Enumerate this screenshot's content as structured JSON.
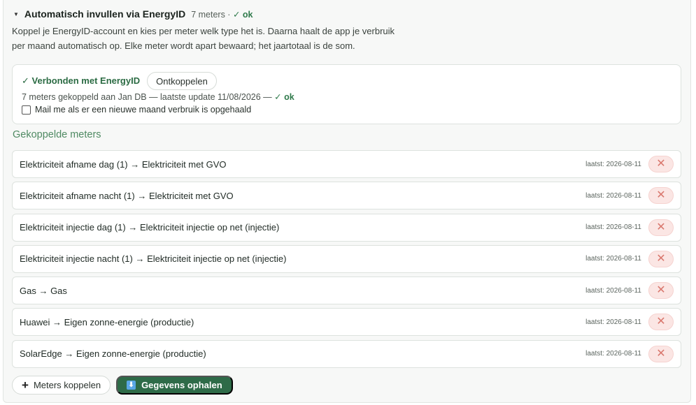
{
  "summary": {
    "caret": "▼",
    "title": "Automatisch invullen via EnergyID",
    "meta": "7 meters ·",
    "status": "✓ ok"
  },
  "intro": "Koppel je EnergyID-account en kies per meter welk type het is. Daarna haalt de app je verbruik per maand automatisch op. Elke meter wordt apart bewaard; het jaartotaal is de som.",
  "connection": {
    "status": "✓ Verbonden met EnergyID",
    "disconnect_label": "Ontkoppelen",
    "details": "7 meters gekoppeld aan Jan DB — laatste update 11/08/2026 —",
    "details_ok": "✓ ok",
    "mail_label": "Mail me als er een nieuwe maand verbruik is opgehaald",
    "mail_checked": false
  },
  "section_title": "Gekoppelde meters",
  "meters": [
    {
      "label": "Elektriciteit afname dag (1) → Elektriciteit met GVO",
      "date": "laatst: 2026-08-11"
    },
    {
      "label": "Elektriciteit afname nacht (1) → Elektriciteit met GVO",
      "date": "laatst: 2026-08-11"
    },
    {
      "label": "Elektriciteit injectie dag (1) → Elektriciteit injectie op net (injectie)",
      "date": "laatst: 2026-08-11"
    },
    {
      "label": "Elektriciteit injectie nacht (1) → Elektriciteit injectie op net (injectie)",
      "date": "laatst: 2026-08-11"
    },
    {
      "label": "Gas → Gas",
      "date": "laatst: 2026-08-11"
    },
    {
      "label": "Huawei → Eigen zonne-energie (productie)",
      "date": "laatst: 2026-08-11"
    },
    {
      "label": "SolarEdge → Eigen zonne-energie (productie)",
      "date": "laatst: 2026-08-11"
    }
  ],
  "delete_glyph": "✕",
  "actions": {
    "add_glyph": "+",
    "add_label": "Meters koppelen",
    "fetch_glyph": "⬇",
    "fetch_label": "Gegevens ophalen"
  },
  "colors": {
    "accent": "#2e6b48",
    "ok": "#2f7a4b",
    "section": "#4f8a63",
    "delete_bg": "#fbe6e4",
    "delete_fg": "#d9776d"
  }
}
